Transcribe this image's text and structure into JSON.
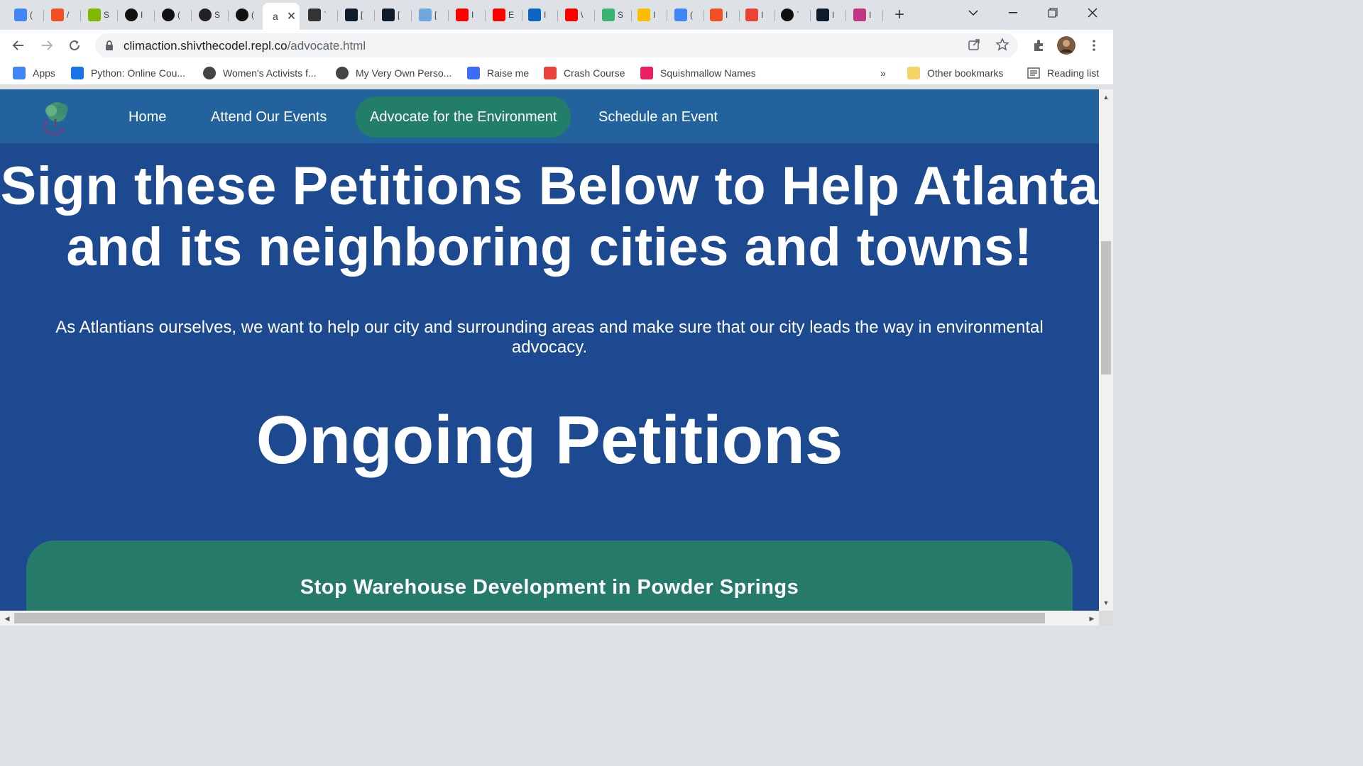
{
  "browser": {
    "tabs": [
      {
        "icon": "google-icon",
        "char": "(",
        "color": "#4285f4"
      },
      {
        "icon": "microsoft-icon",
        "char": "/",
        "color": "#f25022"
      },
      {
        "icon": "microsoft-icon",
        "char": "S",
        "color": "#7fba00"
      },
      {
        "icon": "circle-icon",
        "char": "I",
        "color": "#111111"
      },
      {
        "icon": "spiral-icon",
        "char": "(",
        "color": "#111111"
      },
      {
        "icon": "github-icon",
        "char": "S",
        "color": "#222222"
      },
      {
        "icon": "spiral-icon",
        "char": "(",
        "color": "#111111"
      },
      {
        "icon": "active-tab-icon",
        "char": "a",
        "color": "#ffffff"
      },
      {
        "icon": "clapperboard-icon",
        "char": "`",
        "color": "#333333"
      },
      {
        "icon": "d-logo-icon",
        "char": "[",
        "color": "#0d1b2a"
      },
      {
        "icon": "d-logo-icon",
        "char": "[",
        "color": "#0d1b2a"
      },
      {
        "icon": "layers-icon",
        "char": "[",
        "color": "#6fa8dc"
      },
      {
        "icon": "youtube-icon",
        "char": "I",
        "color": "#ff0000"
      },
      {
        "icon": "youtube-icon",
        "char": "E",
        "color": "#ff0000"
      },
      {
        "icon": "linkedin-icon",
        "char": "I",
        "color": "#0a66c2"
      },
      {
        "icon": "youtube-icon",
        "char": "\\",
        "color": "#ff0000"
      },
      {
        "icon": "p-icon",
        "char": "S",
        "color": "#3cb371"
      },
      {
        "icon": "drive-icon",
        "char": "I",
        "color": "#fbbc04"
      },
      {
        "icon": "docs-icon",
        "char": "(",
        "color": "#4285f4"
      },
      {
        "icon": "microsoft-icon",
        "char": "I",
        "color": "#f25022"
      },
      {
        "icon": "gmail-icon",
        "char": "I",
        "color": "#ea4335"
      },
      {
        "icon": "circle-icon",
        "char": "`",
        "color": "#111111"
      },
      {
        "icon": "d-logo-icon",
        "char": "I",
        "color": "#0d1b2a"
      },
      {
        "icon": "instagram-icon",
        "char": "I",
        "color": "#c13584"
      }
    ],
    "new_tab": "+",
    "url_host": "climaction.shivthecodel.repl.co",
    "url_path": "/advocate.html",
    "bookmarks": [
      {
        "label": "Apps",
        "icon": "apps-grid-icon",
        "color": "#4285f4"
      },
      {
        "label": "Python: Online Cou...",
        "icon": "video-icon",
        "color": "#1a73e8"
      },
      {
        "label": "Women's Activists f...",
        "icon": "globe-icon",
        "color": "#444444"
      },
      {
        "label": "My Very Own Perso...",
        "icon": "globe-icon",
        "color": "#444444"
      },
      {
        "label": "Raise me",
        "icon": "doc-icon",
        "color": "#3b6ef5"
      },
      {
        "label": "Crash Course",
        "icon": "diamond-icon",
        "color": "#e8453c"
      },
      {
        "label": "Squishmallow Names",
        "icon": "flame-icon",
        "color": "#e91e63"
      }
    ],
    "overflow": "»",
    "other_bookmarks": "Other bookmarks",
    "reading_list": "Reading list"
  },
  "nav": {
    "links": [
      "Home",
      "Attend Our Events",
      "Advocate for the Environment",
      "Schedule an Event"
    ],
    "active_index": 2
  },
  "hero": {
    "title": "Sign these Petitions Below to Help Atlanta and its neighboring cities and towns!",
    "intro": "As Atlantians ourselves, we want to help our city and surrounding areas and make sure that our city leads the way in environmental advocacy."
  },
  "petitions": {
    "heading": "Ongoing Petitions",
    "items": [
      {
        "title": "Stop Warehouse Development in Powder Springs"
      }
    ]
  },
  "colors": {
    "page_bg": "#1c4990",
    "navbar_bg": "#23639d",
    "accent_green": "#227d69",
    "card_green": "#267a69"
  }
}
